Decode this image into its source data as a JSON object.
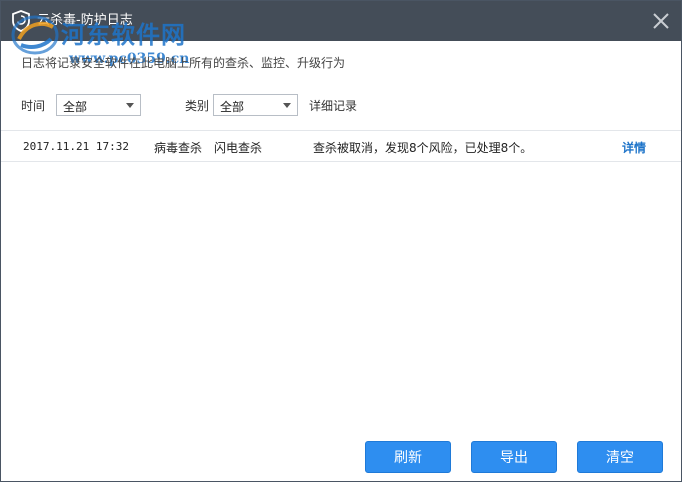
{
  "window": {
    "title": "云杀毒-防护日志",
    "description": "日志将记录安全软件在此电脑上所有的查杀、监控、升级行为"
  },
  "watermark": {
    "name": "河东软件网",
    "url": "www.pc0359.cn"
  },
  "filters": {
    "time_label": "时间",
    "time_value": "全部",
    "category_label": "类别",
    "category_value": "全部",
    "detail_record": "详细记录"
  },
  "log_rows": [
    {
      "time": "2017.11.21 17:32",
      "type": "病毒查杀",
      "subtype": "闪电查杀",
      "result": "查杀被取消，发现8个风险，已处理8个。",
      "action": "详情"
    }
  ],
  "buttons": {
    "refresh": "刷新",
    "export": "导出",
    "clear": "清空"
  },
  "colors": {
    "titlebar": "#444d58",
    "accent": "#2e8ef0",
    "link": "#1e74c9"
  }
}
